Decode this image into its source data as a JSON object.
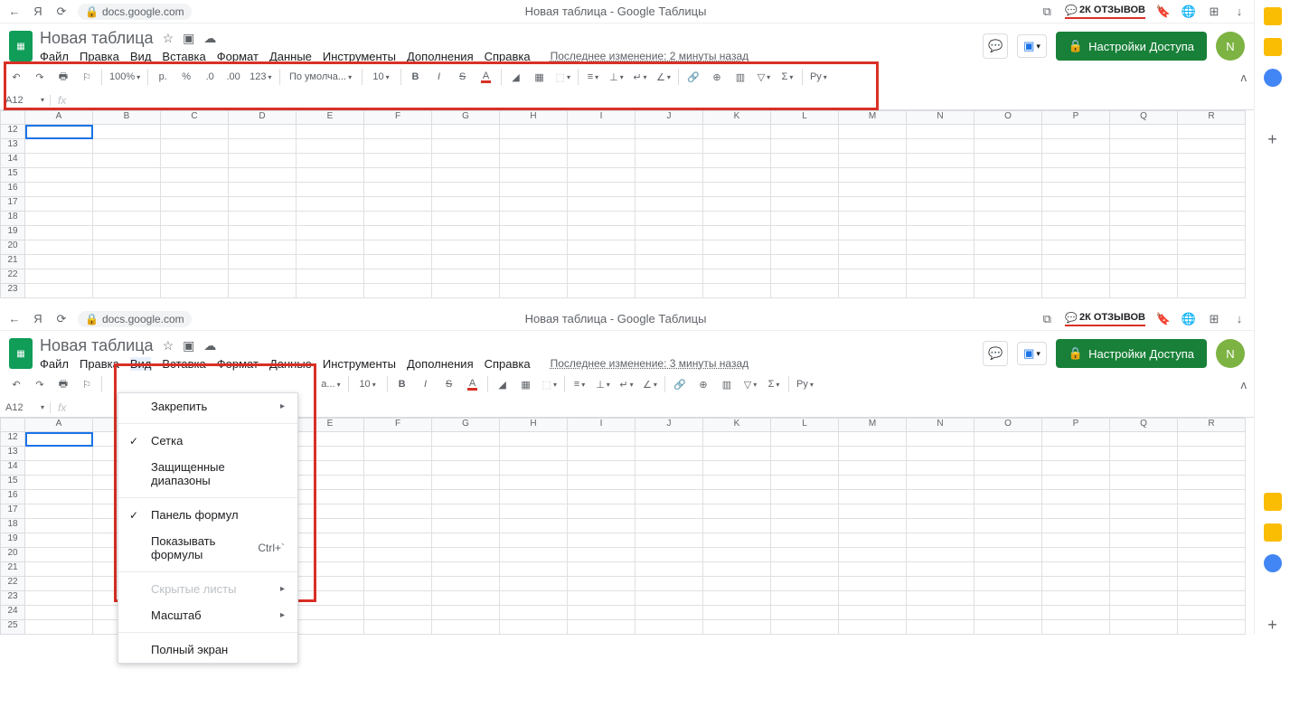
{
  "browser": {
    "url": "docs.google.com",
    "tab_title_1": "Новая таблица - Google Таблицы",
    "tab_title_2": "Новая таблица - Google Таблицы",
    "reviews": "2К ОТЗЫВОВ"
  },
  "doc": {
    "title": "Новая таблица",
    "last_modified_1": "Последнее изменение: 2 минуты назад",
    "last_modified_2": "Последнее изменение: 3 минуты назад"
  },
  "menus": {
    "file": "Файл",
    "edit": "Правка",
    "view": "Вид",
    "insert": "Вставка",
    "format": "Формат",
    "data": "Данные",
    "tools": "Инструменты",
    "addons": "Дополнения",
    "help": "Справка"
  },
  "header_right": {
    "share": "Настройки Доступа",
    "avatar": "N"
  },
  "toolbar": {
    "zoom": "100%",
    "currency": "р.",
    "percent": "%",
    "dec_decrease": ".0",
    "dec_increase": ".00",
    "format_123": "123",
    "font": "По умолча...",
    "font2": "а...",
    "font_size": "10",
    "bold": "B",
    "italic": "I",
    "strike": "S",
    "text_color": "A",
    "p_script": "Pу"
  },
  "name_box": {
    "cell_1": "A12",
    "cell_2": "A12"
  },
  "columns": [
    "A",
    "B",
    "C",
    "D",
    "E",
    "F",
    "G",
    "H",
    "I",
    "J",
    "K",
    "L",
    "M",
    "N",
    "O",
    "P",
    "Q",
    "R"
  ],
  "rows_1": [
    "12",
    "13",
    "14",
    "15",
    "16",
    "17",
    "18",
    "19",
    "20",
    "21",
    "22",
    "23"
  ],
  "rows_2": [
    "12",
    "13",
    "14",
    "15",
    "16",
    "17",
    "18",
    "19",
    "20",
    "21",
    "22",
    "23",
    "24",
    "25"
  ],
  "view_menu": {
    "freeze": "Закрепить",
    "gridlines": "Сетка",
    "protected_ranges": "Защищенные диапазоны",
    "formula_bar": "Панель формул",
    "show_formulas": "Показывать формулы",
    "show_formulas_shortcut": "Ctrl+`",
    "hidden_sheets": "Скрытые листы",
    "zoom": "Масштаб",
    "fullscreen": "Полный экран"
  }
}
